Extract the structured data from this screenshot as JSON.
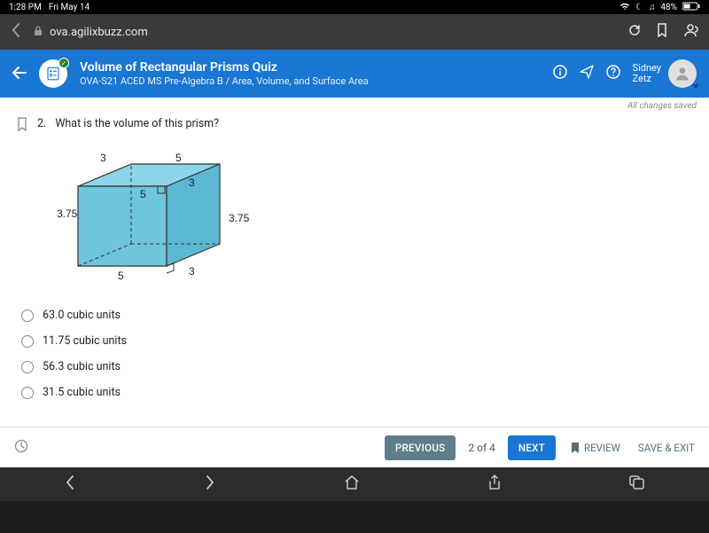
{
  "status": {
    "time": "1:28 PM",
    "date": "Fri May 14",
    "battery": "48%"
  },
  "browser": {
    "url": "ova.agilixbuzz.com"
  },
  "header": {
    "title": "Volume of Rectangular Prisms Quiz",
    "subtitle": "OVA-S21 ACED MS Pre-Algebra B / Area, Volume, and Surface Area",
    "user_first": "Sidney",
    "user_last": "Zetz"
  },
  "content": {
    "saved_msg": "All changes saved",
    "question_number": "2.",
    "question_text": "What is the volume of this prism?",
    "prism": {
      "top_left": "3",
      "top_right": "5",
      "mid_left": "5",
      "mid_right": "3",
      "height_left": "3.75",
      "height_right": "3.75",
      "bottom_left": "5",
      "bottom_right": "3"
    },
    "options": [
      "63.0 cubic units",
      "11.75 cubic units",
      "56.3 cubic units",
      "31.5 cubic units"
    ]
  },
  "footer": {
    "prev": "PREVIOUS",
    "page": "2 of 4",
    "next": "NEXT",
    "review": "REVIEW",
    "save_exit": "SAVE & EXIT"
  }
}
